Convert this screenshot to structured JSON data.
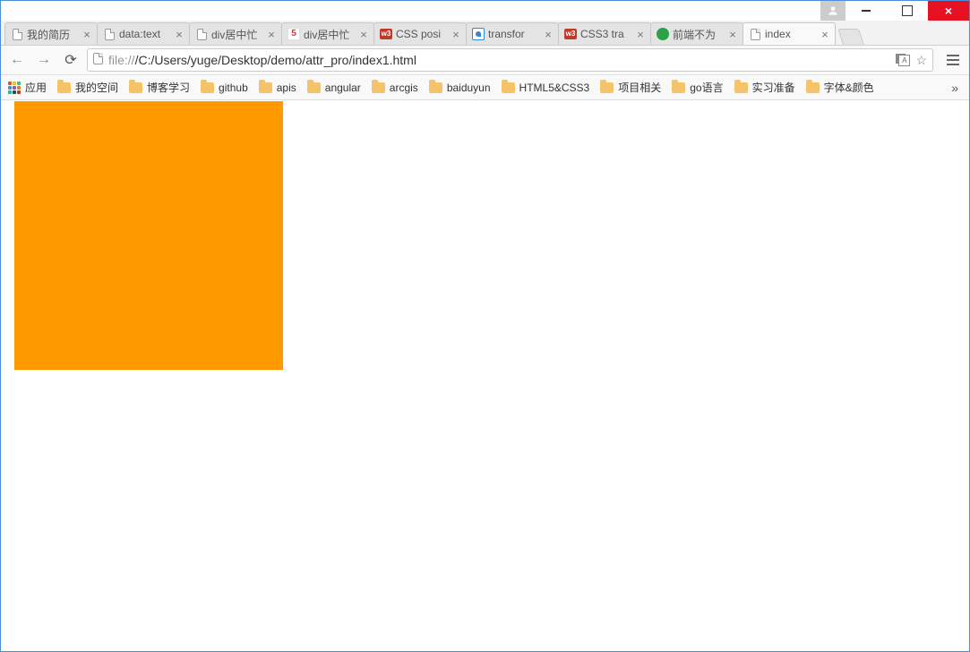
{
  "window": {
    "user_icon": "person-icon",
    "minimize_label": "Minimize",
    "maximize_label": "Maximize",
    "close_label": "×"
  },
  "tabs": [
    {
      "favicon": "page",
      "title": "我的简历"
    },
    {
      "favicon": "page",
      "title": "data:text"
    },
    {
      "favicon": "page",
      "title": "div居中忙"
    },
    {
      "favicon": "five",
      "title": "div居中忙"
    },
    {
      "favicon": "w3",
      "title": "CSS posi"
    },
    {
      "favicon": "baidu",
      "title": "transfor"
    },
    {
      "favicon": "w3",
      "title": "CSS3 tra"
    },
    {
      "favicon": "wechat",
      "title": "前端不为"
    },
    {
      "favicon": "page",
      "title": "index",
      "active": true
    }
  ],
  "address": {
    "scheme": "file://",
    "path": "/C:/Users/yuge/Desktop/demo/attr_pro/index1.html"
  },
  "bookmarks": {
    "apps_label": "应用",
    "items": [
      "我的空间",
      "博客学习",
      "github",
      "apis",
      "angular",
      "arcgis",
      "baiduyun",
      "HTML5&CSS3",
      "项目相关",
      "go语言",
      "实习准备",
      "字体&颜色"
    ],
    "overflow": "»"
  },
  "page": {
    "box_color": "#ff9900"
  }
}
